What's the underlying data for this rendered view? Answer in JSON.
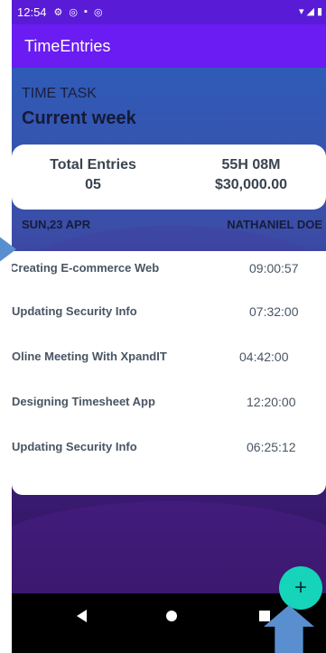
{
  "status_bar": {
    "time": "12:54"
  },
  "app_bar": {
    "title": "TimeEntries"
  },
  "time_task": {
    "label": "TIME TASK",
    "title": "Current week"
  },
  "summary": {
    "total_entries_label": "Total Entries",
    "total_entries_value": "05",
    "hours_label": "55H 08M",
    "amount_value": "$30,000.00"
  },
  "meta": {
    "date": "SUN,23 APR",
    "user": "NATHANIEL DOE"
  },
  "entries": [
    {
      "task": "Creating E-commerce Web",
      "duration": "09:00:57"
    },
    {
      "task": "Updating Security Info",
      "duration": "07:32:00"
    },
    {
      "task": "Oline Meeting With XpandIT",
      "duration": "04:42:00"
    },
    {
      "task": "Designing Timesheet App",
      "duration": "12:20:00"
    },
    {
      "task": "Updating Security Info",
      "duration": "06:25:12"
    }
  ],
  "fab": {
    "label": "+"
  },
  "colors": {
    "appbar": "#6a1cf2",
    "fab": "#16d4b9"
  }
}
